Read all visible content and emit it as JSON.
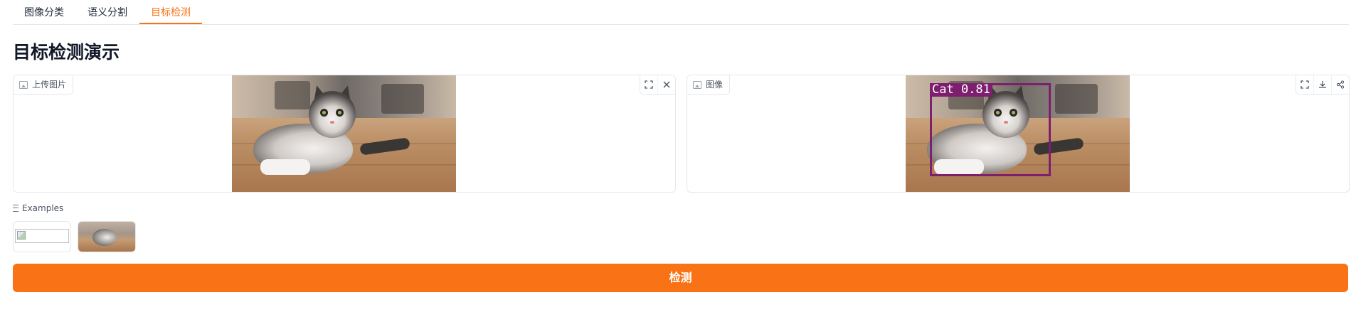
{
  "tabs": [
    {
      "label": "图像分类",
      "active": false
    },
    {
      "label": "语义分割",
      "active": false
    },
    {
      "label": "目标检测",
      "active": true
    }
  ],
  "page_title": "目标检测演示",
  "input_panel": {
    "label": "上传图片"
  },
  "output_panel": {
    "label": "图像",
    "detection": {
      "label_text": "Cat 0.81",
      "box_color": "#7e1e6f"
    }
  },
  "examples": {
    "label": "Examples"
  },
  "detect_button": {
    "label": "检测"
  },
  "colors": {
    "accent": "#f97316",
    "border": "#e5e7eb"
  },
  "icons": {
    "upload_chip": "image-icon",
    "toolbar_input": [
      "fullscreen-icon",
      "close-icon"
    ],
    "toolbar_output": [
      "fullscreen-icon",
      "download-icon",
      "share-icon"
    ],
    "examples": "list-icon"
  }
}
